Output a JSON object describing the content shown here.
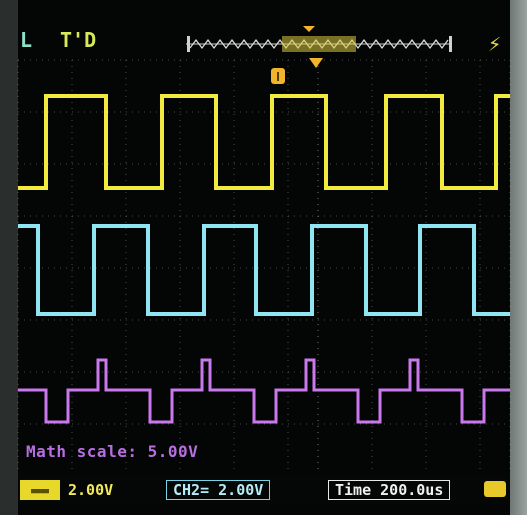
{
  "top_bar": {
    "mode_label": "L",
    "trigger_label": "T'D"
  },
  "channels": {
    "ch1": {
      "scale": "2.00V",
      "color": "#f2ea3c"
    },
    "ch2": {
      "label": "CH2=",
      "scale": "2.00V",
      "color": "#8fe6f2"
    },
    "math": {
      "scale_label": "Math scale: 5.00V",
      "color": "#c978ee"
    }
  },
  "timebase": {
    "label": "Time 200.0us"
  },
  "colors": {
    "grid": "#9aa0a0",
    "trigger_marker": "#f2b42a"
  }
}
